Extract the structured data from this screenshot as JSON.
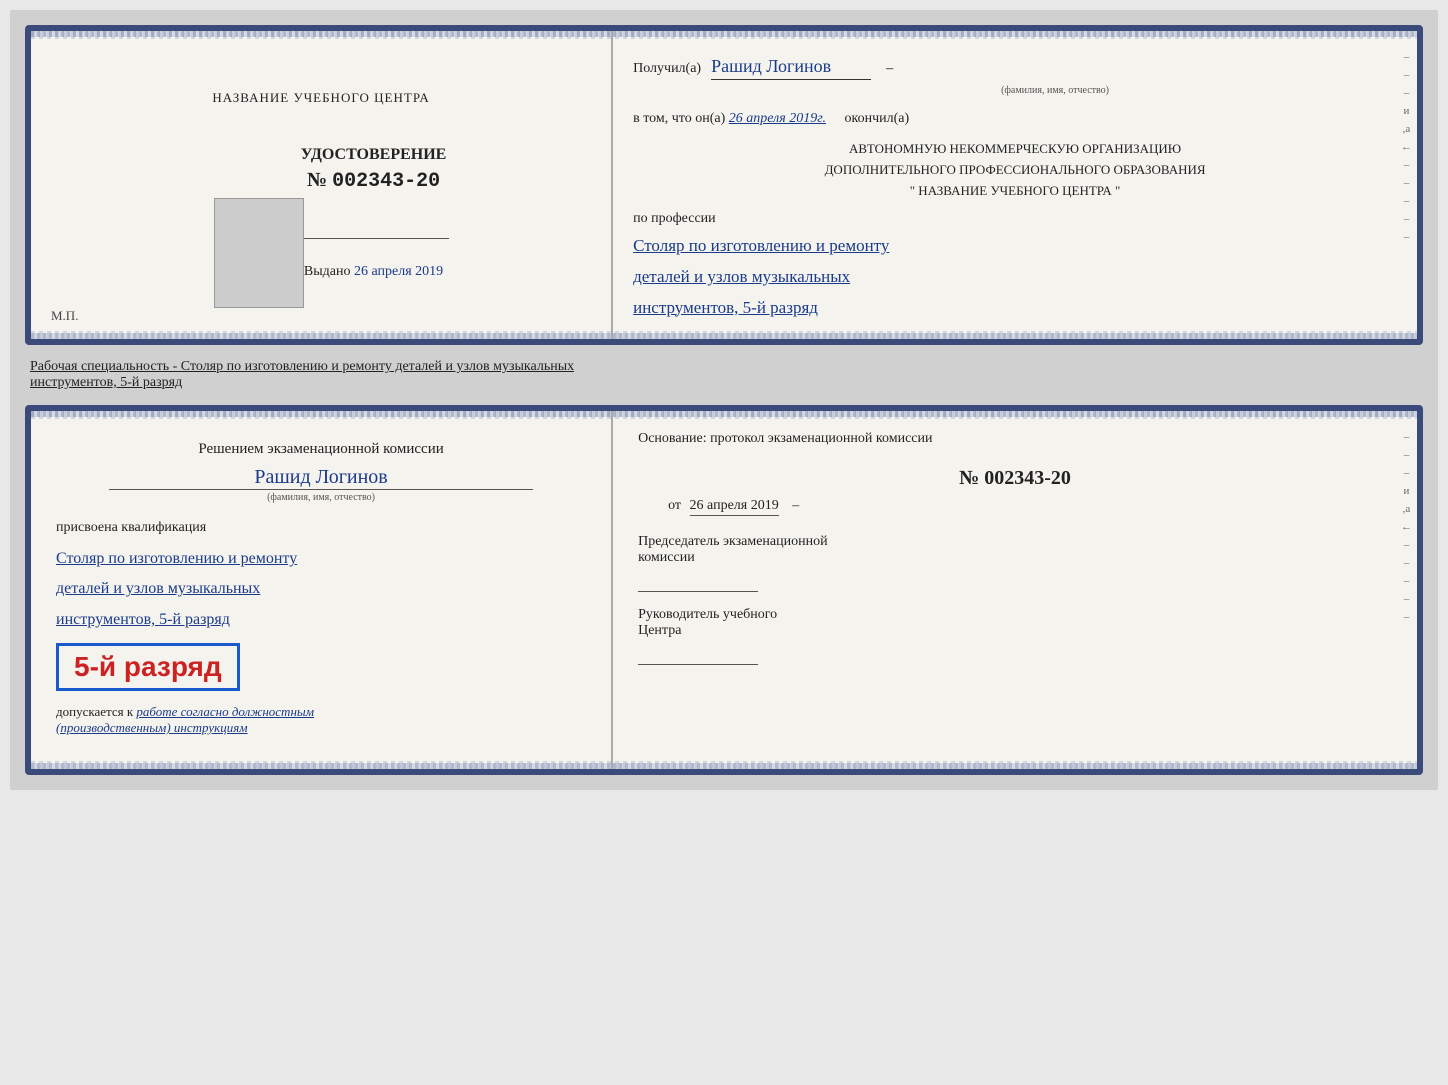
{
  "top_card": {
    "left": {
      "org_name": "НАЗВАНИЕ УЧЕБНОГО ЦЕНТРА",
      "cert_title": "УДОСТОВЕРЕНИЕ",
      "cert_number_prefix": "№",
      "cert_number": "002343-20",
      "issued_label": "Выдано",
      "issued_date": "26 апреля 2019",
      "stamp_label": "М.П."
    },
    "right": {
      "received_label": "Получил(а)",
      "recipient_name": "Рашид Логинов",
      "fio_hint": "(фамилия, имя, отчество)",
      "date_label": "в том, что он(а)",
      "date_value": "26 апреля 2019г.",
      "completed_label": "окончил(а)",
      "org_line1": "АВТОНОМНУЮ НЕКОММЕРЧЕСКУЮ ОРГАНИЗАЦИЮ",
      "org_line2": "ДОПОЛНИТЕЛЬНОГО ПРОФЕССИОНАЛЬНОГО ОБРАЗОВАНИЯ",
      "org_quote": "\"  НАЗВАНИЕ УЧЕБНОГО ЦЕНТРА  \"",
      "profession_label": "по профессии",
      "profession_line1": "Столяр по изготовлению и ремонту",
      "profession_line2": "деталей и узлов музыкальных",
      "profession_line3": "инструментов, 5-й разряд"
    }
  },
  "specialty_text": "Рабочая специальность - Столяр по изготовлению и ремонту деталей и узлов музыкальных",
  "specialty_text2": "инструментов, 5-й разряд",
  "bottom_card": {
    "left": {
      "commission_label": "Решением экзаменационной комиссии",
      "person_name": "Рашид Логинов",
      "fio_hint": "(фамилия, имя, отчество)",
      "qual_label": "присвоена квалификация",
      "qual_line1": "Столяр по изготовлению и ремонту",
      "qual_line2": "деталей и узлов музыкальных",
      "qual_line3": "инструментов, 5-й разряд",
      "rank_badge_text": "5-й разряд",
      "allowed_prefix": "допускается к",
      "allowed_text": "работе согласно должностным",
      "allowed_text2": "(производственным) инструкциям"
    },
    "right": {
      "basis_label": "Основание: протокол экзаменационной комиссии",
      "protocol_number": "№  002343-20",
      "date_prefix": "от",
      "date_value": "26 апреля 2019",
      "chairman_title": "Председатель экзаменационной",
      "chairman_title2": "комиссии",
      "center_head_title": "Руководитель учебного",
      "center_head_title2": "Центра"
    }
  },
  "deco": {
    "right_chars": [
      "–",
      "–",
      "–",
      "и",
      ",а",
      "←",
      "–",
      "–",
      "–",
      "–",
      "–"
    ]
  }
}
